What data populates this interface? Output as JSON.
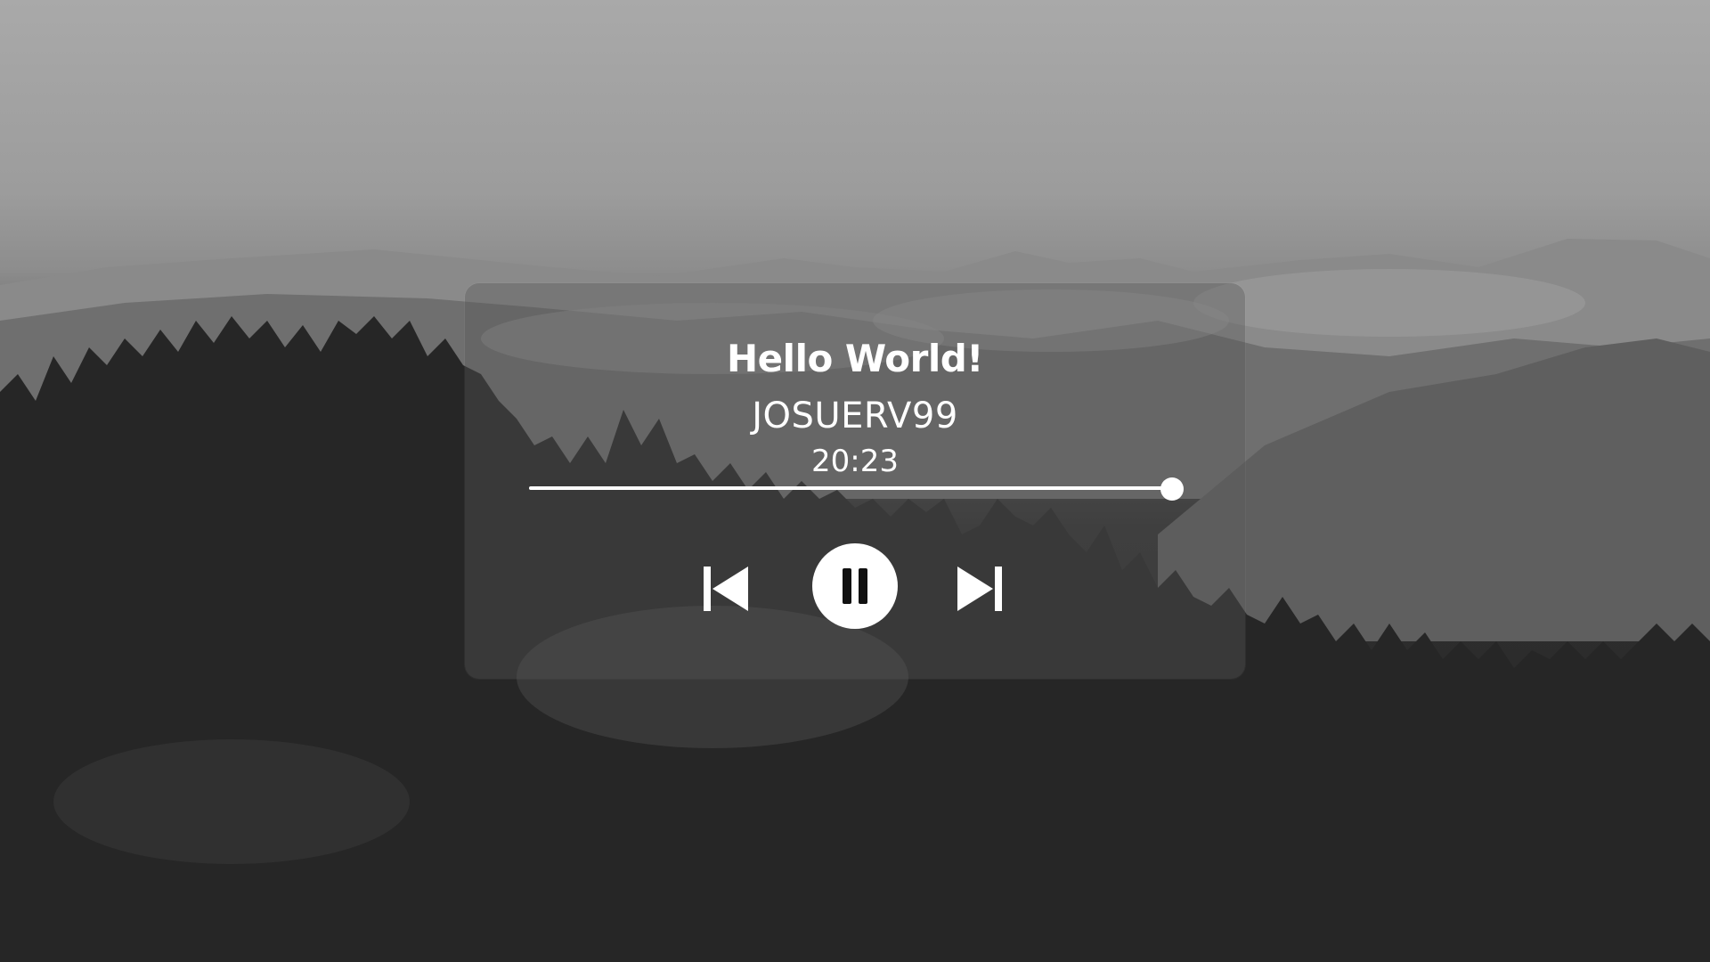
{
  "player": {
    "title": "Hello World!",
    "artist": "JOSUERV99",
    "time": "20:23",
    "progress": 1.0
  },
  "controls": {
    "previous_icon": "skip-previous-icon",
    "play_pause_icon": "pause-icon",
    "next_icon": "skip-next-icon"
  },
  "theme": {
    "text_color": "#ffffff",
    "panel_color": "rgba(90,90,90,0.38)"
  }
}
